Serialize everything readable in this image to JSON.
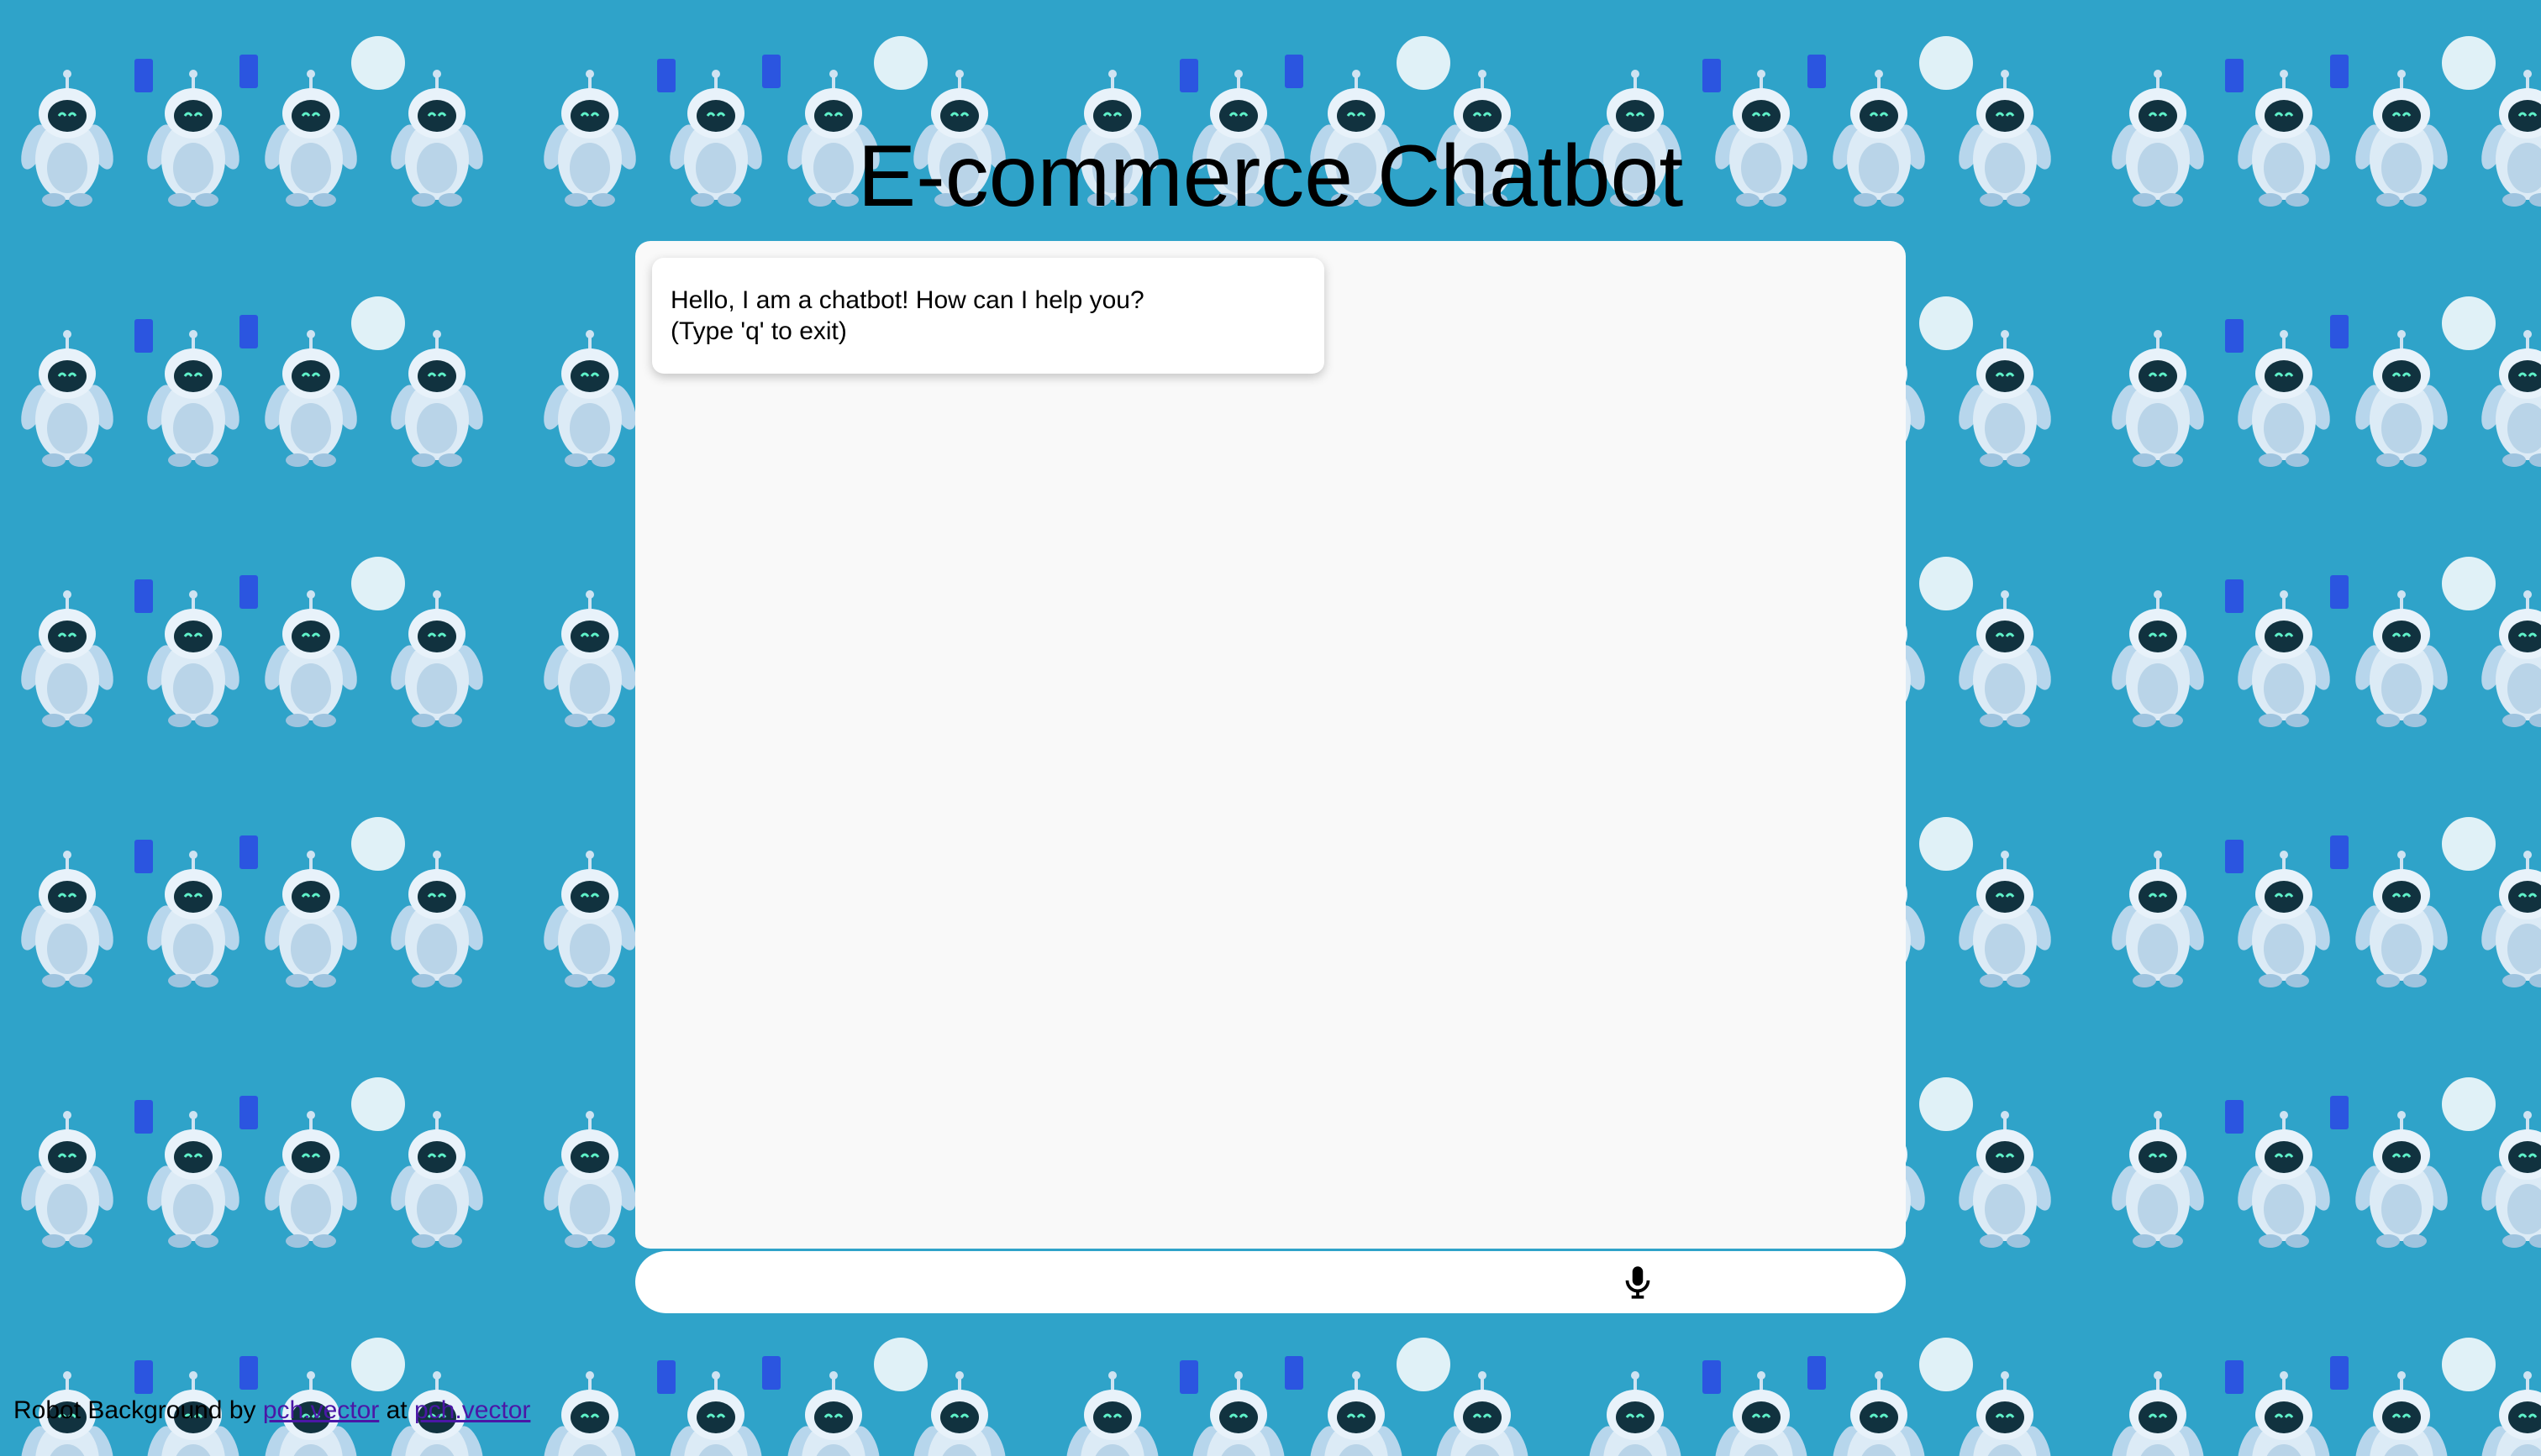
{
  "page": {
    "title": "E-commerce Chatbot",
    "background_color": "#2fa3c9",
    "chat_panel_color": "#f9f9f9"
  },
  "chat": {
    "messages": [
      {
        "sender": "bot",
        "lines": [
          "Hello, I am a chatbot! How can I help you?",
          "(Type 'q' to exit)"
        ]
      }
    ]
  },
  "input": {
    "value": "",
    "placeholder": "",
    "mic_icon": "microphone-icon"
  },
  "footer": {
    "prefix": "Robot Background by",
    "link1": "pch.vector",
    "middle": "at",
    "link2": "pch.vector",
    "link_color": "#4b17a6"
  }
}
